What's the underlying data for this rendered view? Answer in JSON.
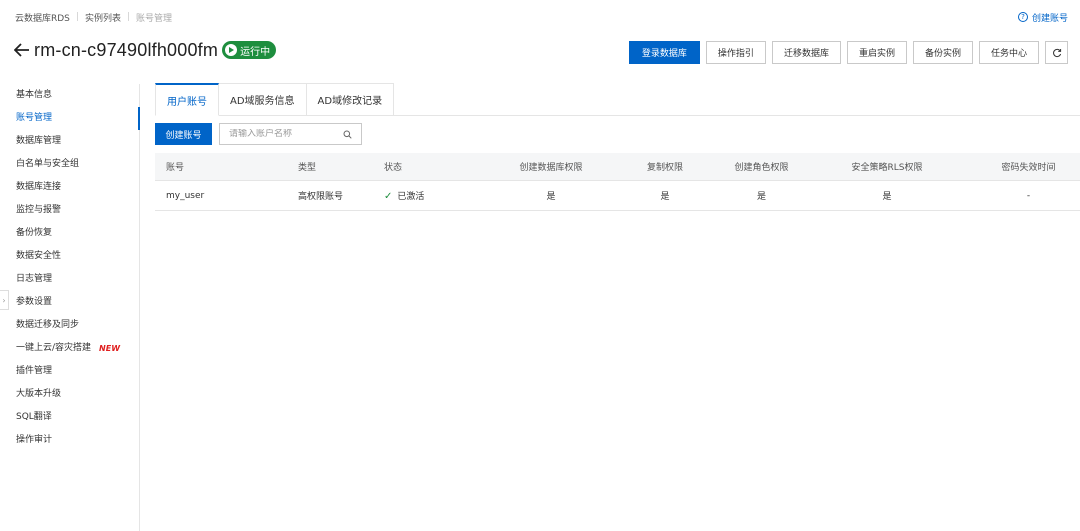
{
  "breadcrumb": [
    "云数据库RDS",
    "实例列表",
    "账号管理"
  ],
  "help_link": "创建账号",
  "instance": {
    "id": "rm-cn-c97490lfh000fm",
    "status": "运行中"
  },
  "actions": [
    "登录数据库",
    "操作指引",
    "迁移数据库",
    "重启实例",
    "备份实例",
    "任务中心"
  ],
  "sidebar": {
    "items": [
      {
        "label": "基本信息"
      },
      {
        "label": "账号管理"
      },
      {
        "label": "数据库管理"
      },
      {
        "label": "白名单与安全组"
      },
      {
        "label": "数据库连接"
      },
      {
        "label": "监控与报警"
      },
      {
        "label": "备份恢复"
      },
      {
        "label": "数据安全性"
      },
      {
        "label": "日志管理"
      },
      {
        "label": "参数设置"
      },
      {
        "label": "数据迁移及同步"
      },
      {
        "label": "一键上云/容灾搭建",
        "badge": "NEW"
      },
      {
        "label": "插件管理"
      },
      {
        "label": "大版本升级"
      },
      {
        "label": "SQL翻译"
      },
      {
        "label": "操作审计"
      }
    ]
  },
  "tabs": [
    "用户账号",
    "AD域服务信息",
    "AD域修改记录"
  ],
  "toolbar": {
    "create_label": "创建账号",
    "search_placeholder": "请输入账户名称"
  },
  "table": {
    "headers": [
      "账号",
      "类型",
      "状态",
      "创建数据库权限",
      "复制权限",
      "创建角色权限",
      "安全策略RLS权限",
      "密码失效时间"
    ],
    "rows": [
      [
        "my_user",
        "高权限账号",
        "已激活",
        "是",
        "是",
        "是",
        "是",
        "-"
      ]
    ]
  },
  "colors": {
    "accent": "#0064c8",
    "running": "#1e8e3e",
    "new_badge": "#e02020"
  }
}
